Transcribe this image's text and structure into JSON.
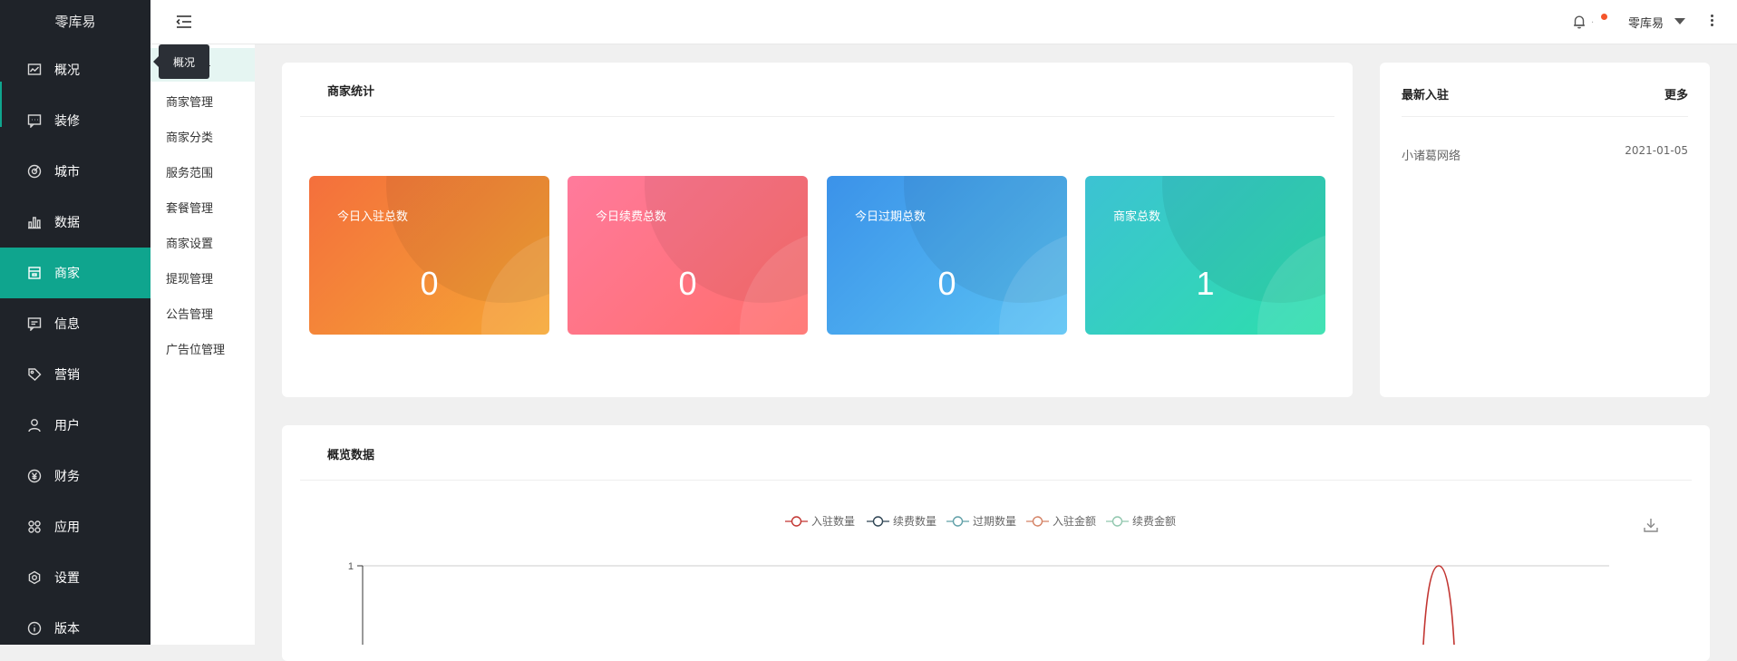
{
  "app": {
    "brand": "零库易"
  },
  "sidebar": {
    "items": [
      {
        "label": "概况",
        "icon": "monitor-chart-icon"
      },
      {
        "label": "装修",
        "icon": "chat-box-icon"
      },
      {
        "label": "城市",
        "icon": "target-icon"
      },
      {
        "label": "数据",
        "icon": "bar-chart-icon"
      },
      {
        "label": "商家",
        "icon": "store-icon",
        "active": true
      },
      {
        "label": "信息",
        "icon": "message-icon"
      },
      {
        "label": "营销",
        "icon": "tag-icon"
      },
      {
        "label": "用户",
        "icon": "user-icon"
      },
      {
        "label": "财务",
        "icon": "yen-icon"
      },
      {
        "label": "应用",
        "icon": "apps-icon"
      },
      {
        "label": "设置",
        "icon": "gear-icon"
      },
      {
        "label": "版本",
        "icon": "info-icon"
      }
    ],
    "accent": "#0fa58e"
  },
  "submenu": {
    "tooltip": "概况",
    "items": [
      "商家管理",
      "商家分类",
      "服务范围",
      "套餐管理",
      "商家设置",
      "提现管理",
      "公告管理",
      "广告位管理"
    ]
  },
  "header": {
    "user": "零库易"
  },
  "stats_card": {
    "title": "商家统计",
    "stats": [
      {
        "label": "今日入驻总数",
        "value": "0"
      },
      {
        "label": "今日续费总数",
        "value": "0"
      },
      {
        "label": "今日过期总数",
        "value": "0"
      },
      {
        "label": "商家总数",
        "value": "1"
      }
    ]
  },
  "recent_card": {
    "title": "最新入驻",
    "more": "更多",
    "rows": [
      {
        "name": "小诸葛网络",
        "date": "2021-01-05"
      }
    ]
  },
  "overview_card": {
    "title": "概览数据"
  },
  "chart_data": {
    "type": "line",
    "legend": [
      "入驻数量",
      "续费数量",
      "过期数量",
      "入驻金额",
      "续费金额"
    ],
    "legend_colors": [
      "#c23531",
      "#2f4554",
      "#61a0a8",
      "#d48265",
      "#91c7ae"
    ],
    "y_ticks": [
      "1"
    ],
    "series_peak": {
      "name": "入驻数量",
      "value": 1
    }
  }
}
